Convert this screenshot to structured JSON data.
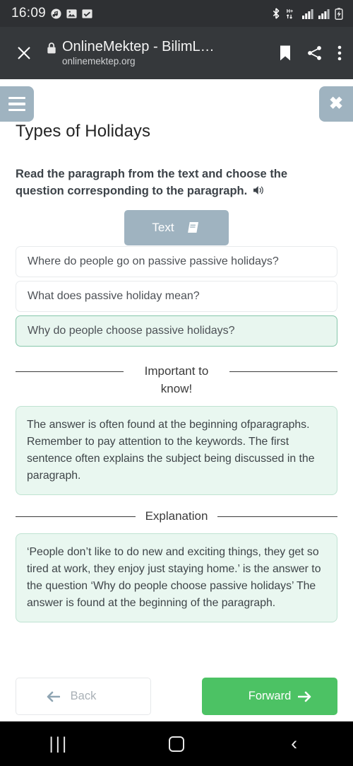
{
  "statusbar": {
    "clock": "16:09",
    "left_icons": [
      "music-note-icon",
      "image-icon",
      "checkbox-icon"
    ],
    "right_icons": [
      "bluetooth-icon",
      "hplus-data-icon",
      "signal-bars-icon",
      "signal-bars-2-icon",
      "battery-charging-icon"
    ]
  },
  "browser": {
    "close_label": "×",
    "title": "OnlineMektep - BilimL…",
    "url": "onlinemektep.org",
    "actions": [
      "bookmark-icon",
      "share-icon",
      "overflow-menu-icon"
    ]
  },
  "page": {
    "menu_label": "menu",
    "close_label": "✖",
    "title": "Types of Holidays",
    "prompt": "Read the paragraph from the text and choose the question corresponding to the paragraph.",
    "text_button": "Text",
    "options": [
      {
        "label": "Where do people go on passive passive holidays?",
        "selected": false
      },
      {
        "label": "What does passive holiday mean?",
        "selected": false
      },
      {
        "label": "Why do people choose passive holidays?",
        "selected": true
      }
    ],
    "important": {
      "title": "Important to know!",
      "body": "The answer is often found at the beginning ofparagraphs. Remember to pay attention to the keywords. The first sentence often explains the subject being discussed in the paragraph."
    },
    "explanation": {
      "title": "Explanation",
      "body": "‘People don’t like to do new and exciting things, they get so tired at work, they enjoy just staying home.’ is the answer to the question ‘Why do people choose passive holidays’ The answer is found at the beginning of the paragraph."
    },
    "nav": {
      "back": "Back",
      "forward": "Forward",
      "back_arrow": "⬅",
      "forward_arrow": "➡"
    }
  },
  "android_nav": {
    "recents": "|||",
    "home": "home-icon",
    "back": "‹"
  },
  "colors": {
    "statusbar_bg": "#2e3033",
    "toolbar_bg": "#35383b",
    "accent_blue_grey": "#9fb3c0",
    "selected_green_bg": "#e8f6ef",
    "selected_green_border": "#86c7ab",
    "forward_green": "#4cc264"
  }
}
